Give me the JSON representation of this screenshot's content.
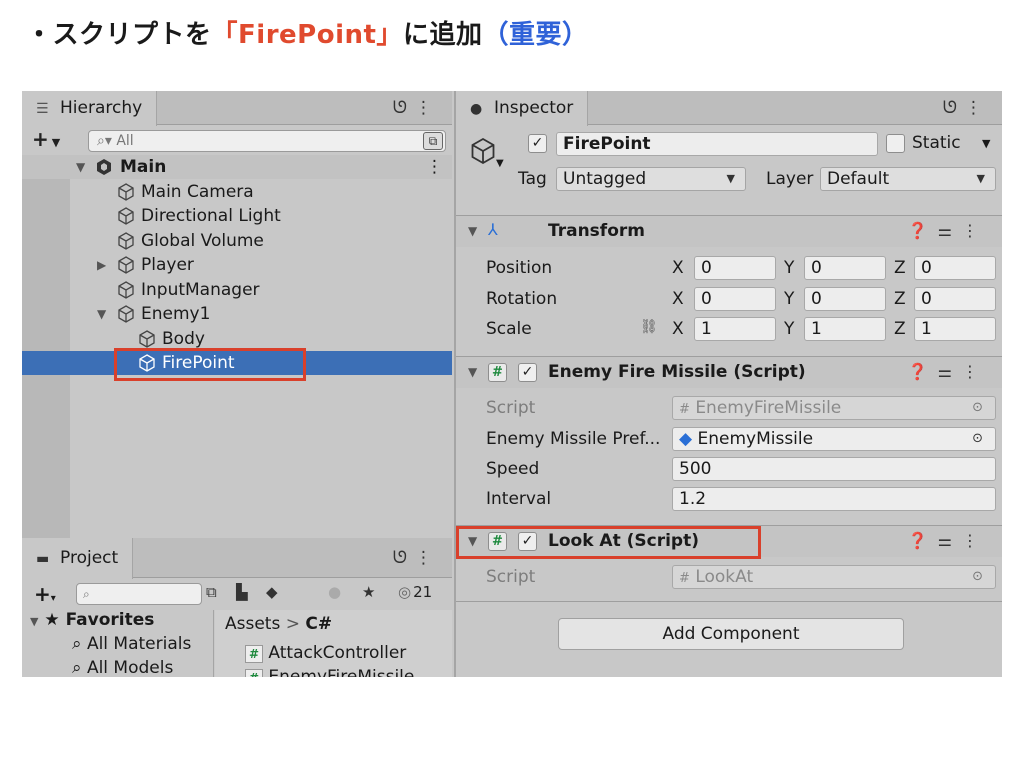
{
  "headline": {
    "bullet": "・",
    "prefix": "スクリプトを",
    "target": "「FirePoint」",
    "middle": "に追加",
    "note": "（重要）"
  },
  "colors": {
    "highlight_red": "#d9402b",
    "selection_blue": "#3c6fb6",
    "note_blue": "#2f62d8"
  },
  "hierarchy": {
    "tab_label": "Hierarchy",
    "search_placeholder": "All",
    "scene": "Main",
    "items": [
      {
        "label": "Main Camera"
      },
      {
        "label": "Directional Light"
      },
      {
        "label": "Global Volume"
      },
      {
        "label": "Player"
      },
      {
        "label": "InputManager"
      },
      {
        "label": "Enemy1"
      },
      {
        "label": "Body"
      },
      {
        "label": "FirePoint"
      }
    ]
  },
  "project": {
    "tab_label": "Project",
    "hidden_count": "21",
    "favorites_label": "Favorites",
    "favorites": [
      "All Materials",
      "All Models"
    ],
    "breadcrumb_root": "Assets",
    "breadcrumb_sep": ">",
    "breadcrumb_current": "C#",
    "files": [
      "AttackController",
      "EnemyFireMissile"
    ]
  },
  "inspector": {
    "tab_label": "Inspector",
    "object_name": "FirePoint",
    "static_label": "Static",
    "tag_label": "Tag",
    "tag_value": "Untagged",
    "layer_label": "Layer",
    "layer_value": "Default",
    "transform": {
      "title": "Transform",
      "rows": [
        {
          "label": "Position",
          "x": "0",
          "y": "0",
          "z": "0"
        },
        {
          "label": "Rotation",
          "x": "0",
          "y": "0",
          "z": "0"
        },
        {
          "label": "Scale",
          "x": "1",
          "y": "1",
          "z": "1"
        }
      ],
      "axis_x": "X",
      "axis_y": "Y",
      "axis_z": "Z"
    },
    "enemy_fire_missile": {
      "title": "Enemy Fire Missile (Script)",
      "script_label": "Script",
      "script_value": "EnemyFireMissile",
      "prefab_label": "Enemy Missile Pref...",
      "prefab_value": "EnemyMissile",
      "speed_label": "Speed",
      "speed_value": "500",
      "interval_label": "Interval",
      "interval_value": "1.2"
    },
    "look_at": {
      "title": "Look At (Script)",
      "script_label": "Script",
      "script_value": "LookAt"
    },
    "add_component_label": "Add Component"
  }
}
